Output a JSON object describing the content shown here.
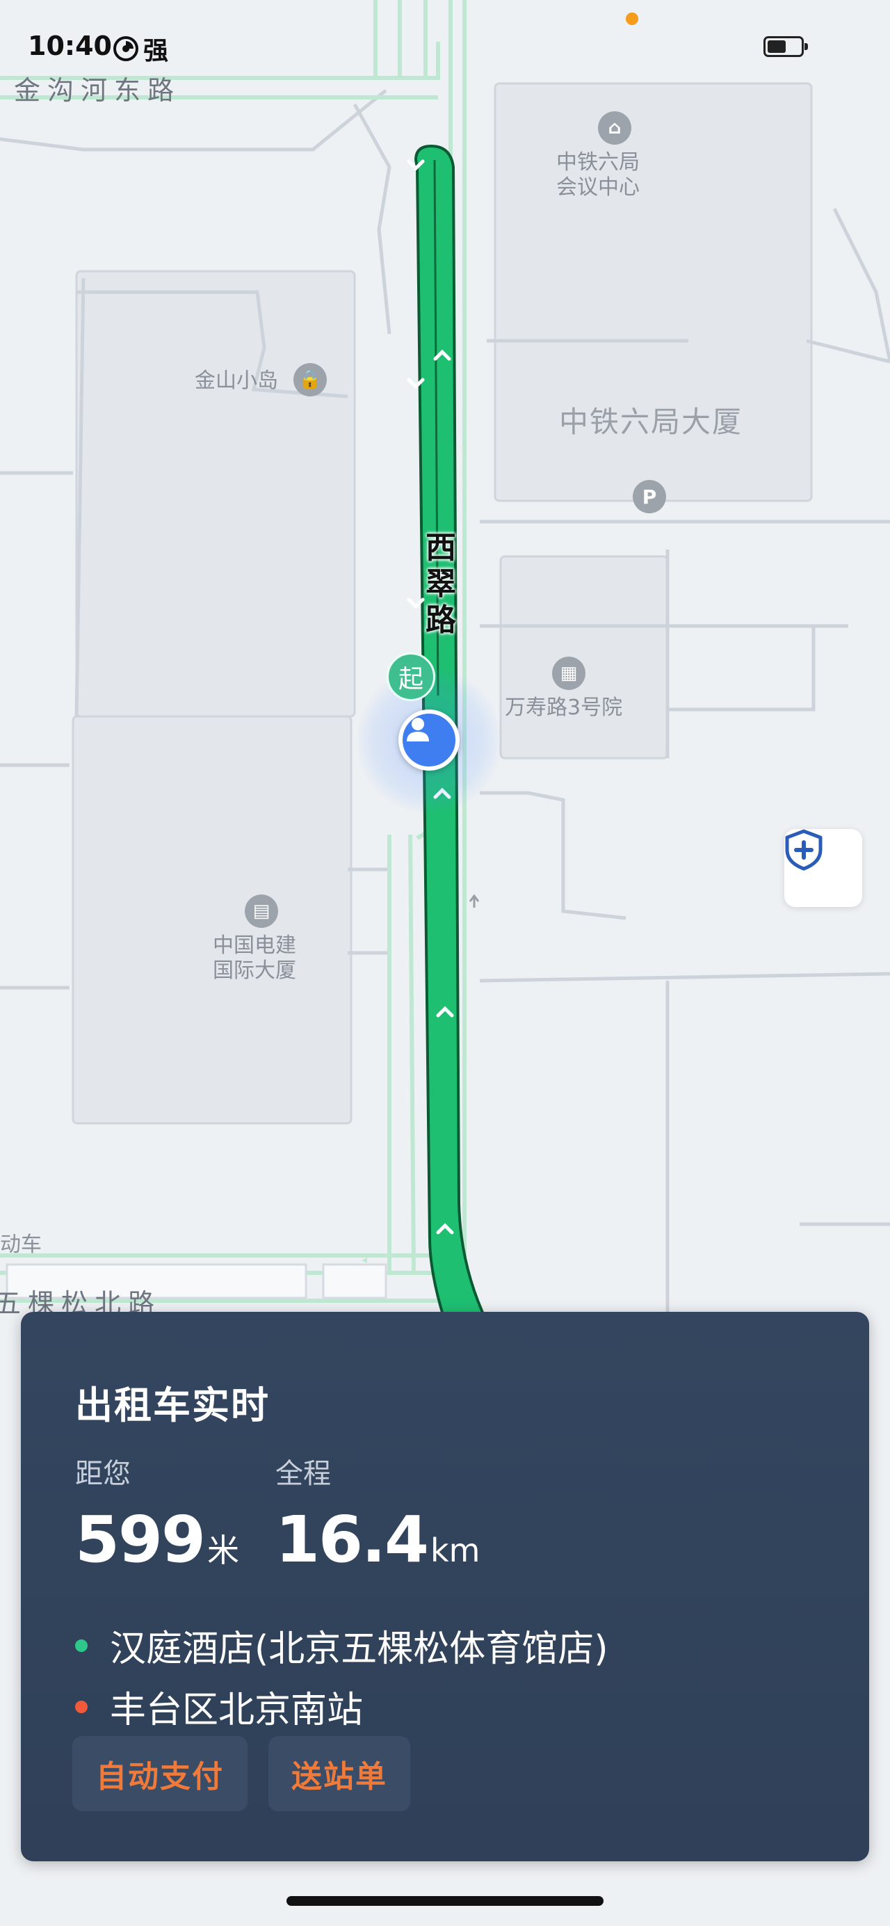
{
  "status_bar": {
    "time": "10:40",
    "signal_label": "强",
    "battery_icon": "battery-icon"
  },
  "map": {
    "road_top": "金沟河东路",
    "road_bottom": "五棵松北路",
    "main_road": "西翠路",
    "poi": {
      "conference_center": "中铁六局\n会议中心",
      "jinshan_island": "金山小岛",
      "building_crcc6": "中铁六局大厦",
      "wanshou_yard": "万寿路3号院",
      "powerchina": "中国电建\n国际大厦",
      "partial_left": "动车"
    },
    "start_marker_label": "起",
    "route_color": "#1fbf72",
    "accent": "#3f7ef0"
  },
  "trip_card": {
    "title": "出租车实时",
    "distance_label": "距您",
    "distance_value": "599",
    "distance_unit": "米",
    "total_label": "全程",
    "total_value": "16.4",
    "total_unit": "km",
    "origin": "汉庭酒店(北京五棵松体育馆店)",
    "destination": "丰台区北京南站",
    "origin_dot_color": "#2ec98a",
    "destination_dot_color": "#f05a3a",
    "chips": [
      "自动支付",
      "送站单"
    ],
    "chip_color": "#f07a3a"
  }
}
